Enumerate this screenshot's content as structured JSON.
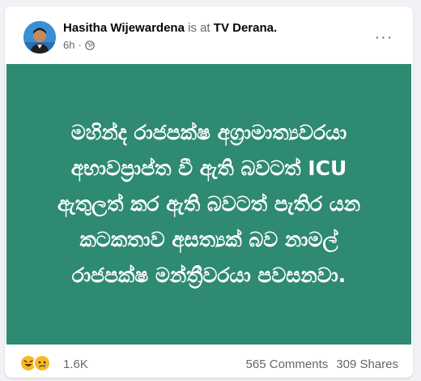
{
  "post": {
    "author_name": "Hasitha Wijewardena",
    "location_prefix": "is at",
    "location": "TV Derana.",
    "timestamp": "6h",
    "separator": "·",
    "privacy_icon": "globe-icon",
    "more_icon": "more-options-icon",
    "more_label": "···",
    "text_lines": [
      "මහින්ද රාජපක්ෂ අග්‍රාමාත්‍යවරයා",
      "අභාවප්‍රාප්ත වී ඇති බවටත් ICU",
      "ඇතුලත් කර ඇති බවටත් පැතිර යන",
      "කටකතාව අසත්‍යක් බව නාමල්",
      "රාජපක්ෂ මන්ත්‍රීවරයා පවසනවා."
    ],
    "panel_color": "#2e8a72"
  },
  "footer": {
    "reaction_icons": [
      "laugh-reaction-icon",
      "sad-reaction-icon"
    ],
    "reaction_count": "1.6K",
    "comments": "565 Comments",
    "shares": "309 Shares"
  }
}
